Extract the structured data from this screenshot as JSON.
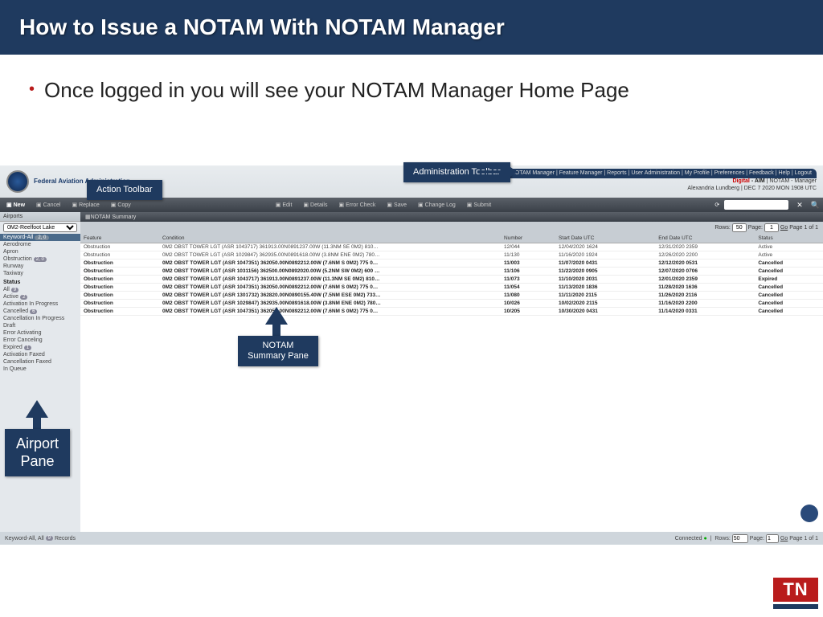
{
  "slide": {
    "title": "How to Issue a NOTAM With NOTAM Manager",
    "bullet": "Once logged in you will see your NOTAM Manager Home Page"
  },
  "callouts": {
    "action_toolbar": "Action Toolbar",
    "admin_toolbar": "Administration Toolbar",
    "summary_pane": "NOTAM Summary Pane",
    "airport_pane": "Airport Pane"
  },
  "app": {
    "agency": "Federal Aviation Administration",
    "nav": "NOTAM Manager  |  Feature Manager  |  Reports  |  User Administration  |  My Profile  |  Preferences  |  Feedback  |  Help  |  Logout",
    "brand_digital": "Digital",
    "brand_aim": " - AIM ",
    "brand_rest": "| NOTAM - Manager",
    "user_line": "Alexandria Lundberg | DEC 7 2020 MON 1908 UTC",
    "toolbar": {
      "new": "New",
      "cancel": "Cancel",
      "replace": "Replace",
      "copy": "Copy",
      "edit": "Edit",
      "details": "Details",
      "errorchk": "Error Check",
      "save": "Save",
      "changelog": "Change Log",
      "submit": "Submit"
    },
    "search_placeholder": "Search"
  },
  "sidebar": {
    "airports_hdr": "Airports",
    "airport_selected": "0M2-Reelfoot Lake",
    "keyword_row": "Keyword-All",
    "keyword_badge": "2, 0",
    "items": [
      "Aerodrome",
      "Apron",
      "Obstruction",
      "Runway",
      "Taxiway"
    ],
    "obstruction_cnt": "2, 0",
    "status_hdr": "Status",
    "status": [
      "All",
      "Active",
      "Activation In Progress",
      "Cancelled",
      "Cancellation In Progress",
      "Draft",
      "Error Activating",
      "Error Canceling",
      "Expired",
      "Activation Faxed",
      "Cancellation Faxed",
      "In Queue"
    ],
    "all_cnt": "9",
    "active_cnt": "2",
    "cancelled_cnt": "6",
    "expired_cnt": "1"
  },
  "summary": {
    "title": "NOTAM Summary",
    "rows_label": "Rows:",
    "rows_val": "50",
    "page_label": "Page:",
    "page_val": "1",
    "go": "Go",
    "page_of": "Page 1 of 1",
    "cols": {
      "feature": "Feature",
      "condition": "Condition",
      "number": "Number",
      "start": "Start Date UTC",
      "end": "End Date UTC",
      "status": "Status"
    },
    "data": [
      {
        "f": "Obstruction",
        "c": "0M2 OBST TOWER LGT (ASR 1043717) 361913.00N0891237.00W (11.3NM SE 0M2) 810…",
        "n": "12/044",
        "s": "12/04/2020 1624",
        "e": "12/31/2020 2359",
        "st": "Active",
        "bold": false
      },
      {
        "f": "Obstruction",
        "c": "0M2 OBST TOWER LGT (ASR 1029847) 362935.00N0891618.00W (3.8NM ENE 0M2) 780…",
        "n": "11/130",
        "s": "11/16/2020 1924",
        "e": "12/26/2020 2200",
        "st": "Active",
        "bold": false
      },
      {
        "f": "Obstruction",
        "c": "0M2 OBST TOWER LGT (ASR 1047351) 362050.00N0892212.00W (7.6NM S 0M2) 775 0…",
        "n": "11/003",
        "s": "11/07/2020 0431",
        "e": "12/12/2020 0531",
        "st": "Cancelled",
        "bold": true
      },
      {
        "f": "Obstruction",
        "c": "0M2 OBST TOWER LGT (ASR 1031156) 362500.00N0892020.00W (5.2NM SW 0M2) 600 …",
        "n": "11/106",
        "s": "11/22/2020 0905",
        "e": "12/07/2020 0706",
        "st": "Cancelled",
        "bold": true
      },
      {
        "f": "Obstruction",
        "c": "0M2 OBST TOWER LGT (ASR 1043717) 361913.00N0891237.00W (11.3NM SE 0M2) 810…",
        "n": "11/073",
        "s": "11/10/2020 2031",
        "e": "12/01/2020 2359",
        "st": "Expired",
        "bold": true
      },
      {
        "f": "Obstruction",
        "c": "0M2 OBST TOWER LGT (ASR 1047351) 362050.00N0892212.00W (7.6NM S 0M2) 775 0…",
        "n": "11/054",
        "s": "11/13/2020 1836",
        "e": "11/28/2020 1636",
        "st": "Cancelled",
        "bold": true
      },
      {
        "f": "Obstruction",
        "c": "0M2 OBST TOWER LGT (ASR 1301732) 362820.00N0890155.40W (7.5NM ESE 0M2) 733…",
        "n": "11/080",
        "s": "11/11/2020 2115",
        "e": "11/26/2020 2116",
        "st": "Cancelled",
        "bold": true
      },
      {
        "f": "Obstruction",
        "c": "0M2 OBST TOWER LGT (ASR 1029847) 362935.00N0891618.00W (3.8NM ENE 0M2) 780…",
        "n": "10/026",
        "s": "10/02/2020 2115",
        "e": "11/16/2020 2200",
        "st": "Cancelled",
        "bold": true
      },
      {
        "f": "Obstruction",
        "c": "0M2 OBST TOWER LGT (ASR 1047351) 362050.00N0892212.00W (7.6NM S 0M2) 775 0…",
        "n": "10/205",
        "s": "10/30/2020 0431",
        "e": "11/14/2020 0331",
        "st": "Cancelled",
        "bold": true
      }
    ]
  },
  "footer": {
    "left": "Keyword-All, All",
    "left_cnt": "9",
    "records": "Records",
    "connected": "Connected",
    "rows": "Rows:",
    "rows_v": "50",
    "page": "Page:",
    "page_v": "1",
    "go": "Go",
    "page_of": "Page 1 of 1"
  },
  "logo": {
    "tn": "TN"
  }
}
